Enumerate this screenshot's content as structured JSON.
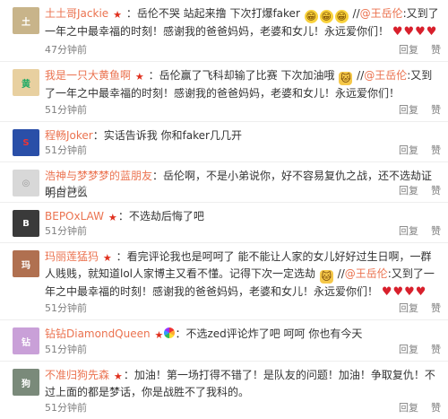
{
  "actions": {
    "reply": "回复",
    "like": "赞"
  },
  "comments": [
    {
      "user": "土土哥Jackie",
      "text1": "：岳伦不哭 站起来撸 下次打爆faker",
      "text2": "//",
      "mention": "@王岳伦",
      "text3": ":又到了一年之中最幸福的时刻！感谢我的爸爸妈妈，老婆和女儿！永远爱你们！",
      "time": "47分钟前"
    },
    {
      "user": "我是一只大黄鱼啊",
      "text1": "：岳伦赢了飞科却输了比赛 下次加油哦",
      "text2": "//",
      "mention": "@王岳伦",
      "text3": ":又到了一年之中最幸福的时刻！感谢我的爸爸妈妈，老婆和女儿！永远爱你们！",
      "time": "51分钟前"
    },
    {
      "user": "程畅Joker",
      "text1": "：实话告诉我 你和faker几几开",
      "time": "51分钟前"
    },
    {
      "user": "浩神与梦梦梦的蓝朋友",
      "text1": "：岳伦啊，不是小弟说你，好不容易复仇之战，还不选劫证明自己么",
      "time": "51分钟前"
    },
    {
      "user": "BEPOxLAW",
      "text1": "：不选劫后悔了吧",
      "time": "51分钟前"
    },
    {
      "user": "玛丽莲猛犸",
      "text1": "：看完评论我也是呵呵了 能不能让人家的女儿好好过生日啊，一群人贱贱，就知道lol人家博主又看不懂。记得下次一定选劫",
      "text2": "//",
      "mention": "@王岳伦",
      "text3": ":又到了一年之中最幸福的时刻！感谢我的爸爸妈妈，老婆和女儿！永远爱你们！",
      "time": "51分钟前"
    },
    {
      "user": "钻钻DiamondQueen",
      "text1": "：不选zed评论炸了吧 呵呵 你也有今天",
      "time": "51分钟前"
    },
    {
      "user": "不准归狗先森",
      "text1": "：加油！第一场打得不错了！是队友的问题！加油！争取复仇！不过上面的都是梦话，你是战胜不了我科的。",
      "time": "51分钟前"
    }
  ]
}
